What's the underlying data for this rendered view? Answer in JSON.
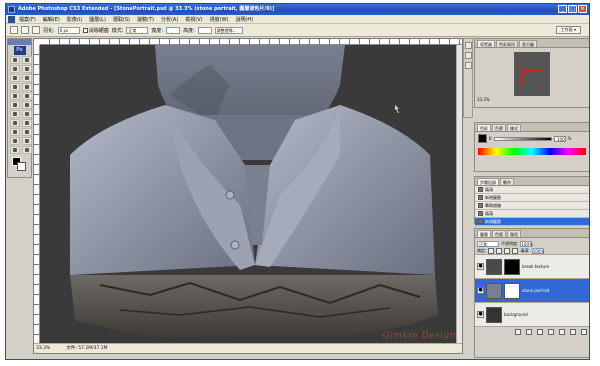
{
  "window": {
    "title": "Adobe Photoshop CS3 Extended - [StonePortrait.psd @ 33.3% (stone portrait, 圖層遮色片/8)]",
    "controls": [
      "_",
      "□",
      "×"
    ]
  },
  "menu": {
    "items": [
      "檔案(F)",
      "編輯(E)",
      "影像(I)",
      "圖層(L)",
      "選取(S)",
      "濾鏡(T)",
      "分析(A)",
      "檢視(V)",
      "視窗(W)",
      "說明(H)"
    ]
  },
  "options": {
    "feather_label": "羽化:",
    "feather_value": "0 px",
    "antialias_label": "消除鋸齒",
    "style_label": "樣式:",
    "style_value": "正常",
    "width_label": "寬度:",
    "height_label": "高度:",
    "refine_label": "調整邊緣...",
    "workspace_label": "工作區 ▾"
  },
  "document": {
    "zoom": "33.3%",
    "doc_size": "文件: 57.2M/37.1M"
  },
  "watermark": "Gimkin Design",
  "navigator": {
    "tabs": [
      "導覽器",
      "色彩資訊",
      "直方圖"
    ],
    "zoom": "33.3%"
  },
  "color_panel": {
    "tabs": [
      "色彩",
      "色票",
      "樣式"
    ],
    "channel_label": "K",
    "channel_value": "100",
    "percent": "%"
  },
  "history": {
    "tabs": [
      "步驟記錄",
      "動作"
    ],
    "rows": [
      "填滿",
      "新增圖層",
      "筆刷描繪",
      "填滿",
      "新增圖層"
    ]
  },
  "layers": {
    "tabs": [
      "圖層",
      "色版",
      "路徑"
    ],
    "blend_mode": "正常",
    "opacity_label": "不透明度:",
    "opacity_value": "100%",
    "lock_label": "鎖定:",
    "fill_label": "填滿:",
    "fill_value": "100%",
    "rows": [
      {
        "name": "break texture"
      },
      {
        "name": "stone portrait"
      },
      {
        "name": "background"
      }
    ]
  },
  "colors": {
    "title_bar": "#2558c8",
    "canvas_bg": "#3a3a3a",
    "selection": "#3168d3",
    "watermark": "#b83a2b"
  }
}
